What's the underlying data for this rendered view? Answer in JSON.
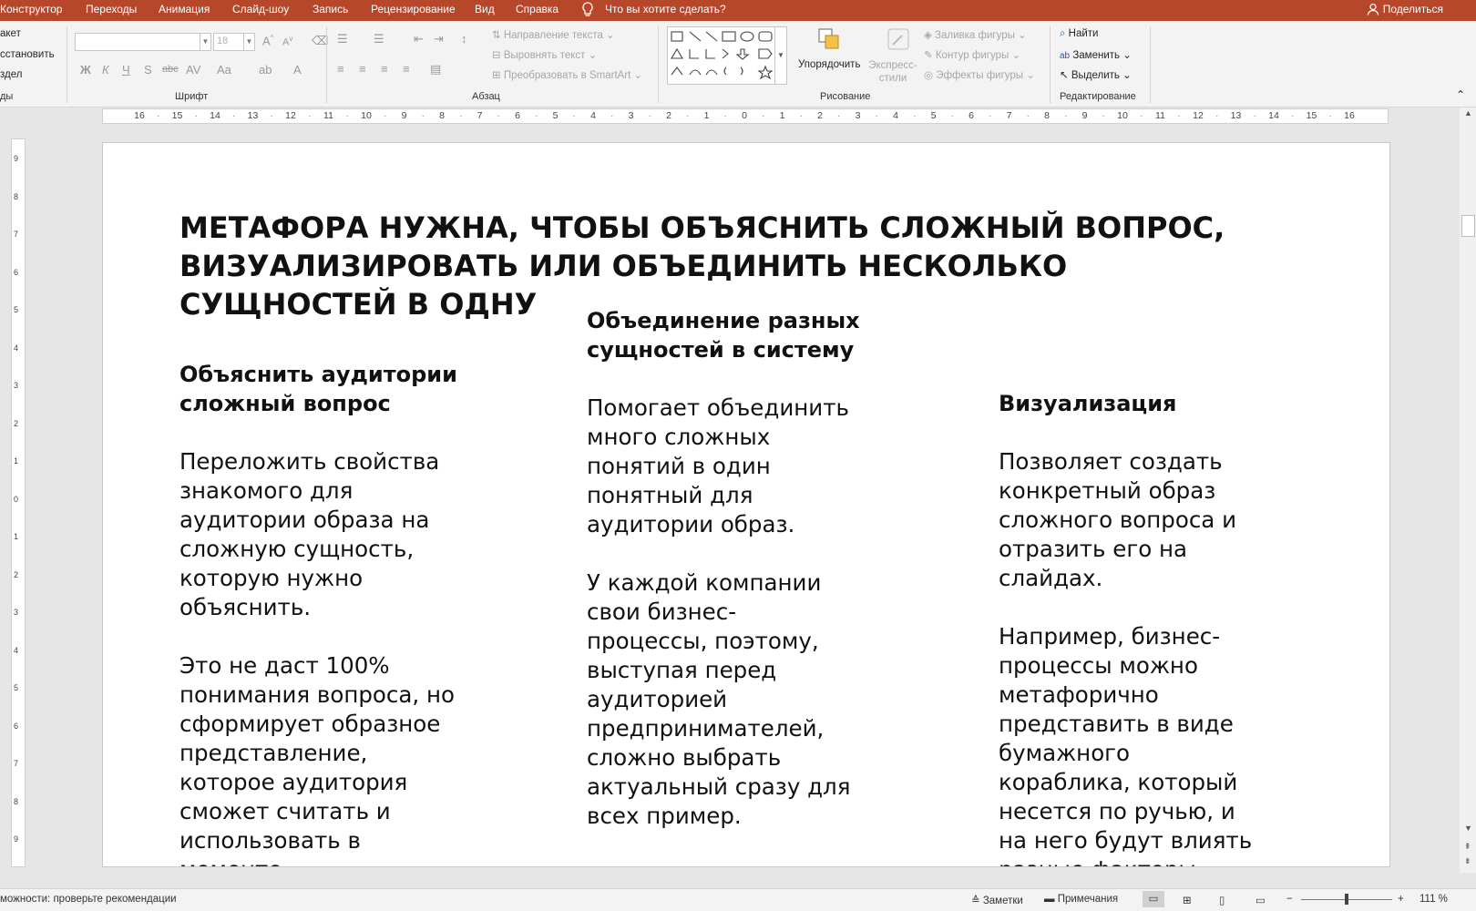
{
  "menu": {
    "items": [
      "Конструктор",
      "Переходы",
      "Анимация",
      "Слайд-шоу",
      "Запись",
      "Рецензирование",
      "Вид",
      "Справка"
    ],
    "tell_me": "Что вы хотите сделать?",
    "share": "Поделиться"
  },
  "ribbon": {
    "slides_cut": [
      "акет",
      "сстановить",
      "здел",
      "ды"
    ],
    "font": {
      "font_name": "",
      "font_size": "18",
      "group_label": "Шрифт"
    },
    "paragraph": {
      "direction": "Направление текста",
      "align": "Выровнять текст",
      "smartart": "Преобразовать в SmartArt",
      "group_label": "Абзац"
    },
    "drawing": {
      "arrange": "Упорядочить",
      "quick_styles": "Экспресс-стили",
      "fill": "Заливка фигуры",
      "outline": "Контур фигуры",
      "effects": "Эффекты фигуры",
      "group_label": "Рисование"
    },
    "editing": {
      "find": "Найти",
      "replace": "Заменить",
      "select": "Выделить",
      "group_label": "Редактирование"
    }
  },
  "ruler": {
    "h_labels": [
      "16",
      "15",
      "14",
      "13",
      "12",
      "11",
      "10",
      "9",
      "8",
      "7",
      "6",
      "5",
      "4",
      "3",
      "2",
      "1",
      "0",
      "1",
      "2",
      "3",
      "4",
      "5",
      "6",
      "7",
      "8",
      "9",
      "10",
      "11",
      "12",
      "13",
      "14",
      "15",
      "16"
    ],
    "v_labels": [
      "9",
      "8",
      "7",
      "6",
      "5",
      "4",
      "3",
      "2",
      "1",
      "0",
      "1",
      "2",
      "3",
      "4",
      "5",
      "6",
      "7",
      "8",
      "9"
    ]
  },
  "slide": {
    "title": "МЕТАФОРА НУЖНА, ЧТОБЫ ОБЪЯСНИТЬ СЛОЖНЫЙ ВОПРОС, ВИЗУАЛИЗИРОВАТЬ ИЛИ ОБЪЕДИНИТЬ НЕСКОЛЬКО СУЩНОСТЕЙ В ОДНУ",
    "col1": {
      "heading": [
        "Объяснить аудитории",
        "сложный вопрос"
      ],
      "p1": [
        "Переложить свойства",
        "знакомого для",
        "аудитории образа на",
        "сложную сущность,",
        "которую нужно",
        "объяснить."
      ],
      "p2": [
        "Это не даст 100%",
        "понимания вопроса, но",
        "сформирует образное",
        "представление,",
        "которое аудитория",
        "сможет считать и",
        "использовать в",
        "моменте"
      ]
    },
    "col2": {
      "heading": [
        "Объединение разных",
        "сущностей в систему"
      ],
      "p1": [
        "Помогает объединить",
        "много сложных",
        "понятий в один",
        "понятный для",
        "аудитории образ."
      ],
      "p2": [
        "У каждой компании",
        "свои бизнес-",
        "процессы, поэтому,",
        "выступая перед",
        "аудиторией",
        "предпринимателей,",
        "сложно выбрать",
        "актуальный сразу для",
        "всех пример."
      ]
    },
    "col3": {
      "heading": [
        "Визуализация"
      ],
      "p1": [
        "Позволяет создать",
        "конкретный образ",
        "сложного вопроса и",
        "отразить его на",
        "слайдах."
      ],
      "p2": [
        "Например, бизнес-",
        "процессы можно",
        "метафорично",
        "представить в виде",
        "бумажного",
        "кораблика, который",
        "несется по ручью, и",
        "на него будут влиять",
        "разные факторы."
      ]
    }
  },
  "status": {
    "accessibility": "можности: проверьте рекомендации",
    "notes": "Заметки",
    "comments": "Примечания",
    "zoom": "111 %"
  },
  "colors": {
    "accent": "#b7472a",
    "ribbon_bg": "#f3f3f3",
    "workspace": "#e6e6e6"
  }
}
